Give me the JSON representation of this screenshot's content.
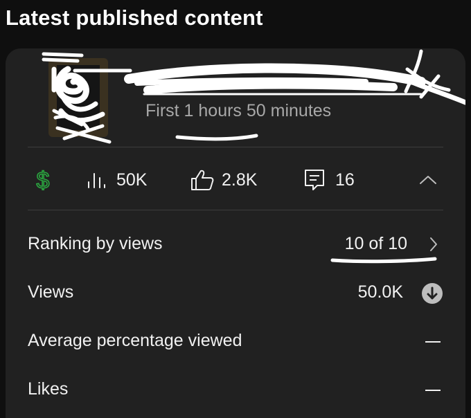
{
  "page_title": "Latest published content",
  "video": {
    "title": "",
    "subtitle": "First 1 hours 50 minutes"
  },
  "stats": {
    "revenue_icon": "dollar-icon",
    "views": "50K",
    "likes": "2.8K",
    "comments": "16",
    "collapse_icon": "chevron-up-icon"
  },
  "metrics": [
    {
      "label": "Ranking by views",
      "value": "10 of 10",
      "icon": "chevron-right-icon"
    },
    {
      "label": "Views",
      "value": "50.0K",
      "icon": "arrow-down-circle-icon"
    },
    {
      "label": "Average percentage viewed",
      "value": "",
      "icon": "dash-icon"
    },
    {
      "label": "Likes",
      "value": "",
      "icon": "dash-icon"
    }
  ],
  "colors": {
    "background": "#0f0f0f",
    "card": "#212121",
    "revenue_green": "#2ba640",
    "text": "#f1f1f1",
    "muted": "#a8a8a8"
  }
}
